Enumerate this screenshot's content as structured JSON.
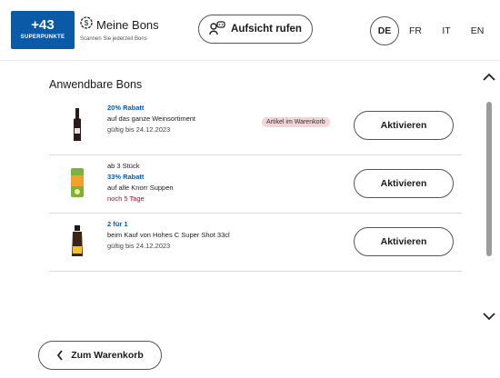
{
  "header": {
    "points_value": "+43",
    "points_label": "SUPERPUNKTE",
    "title": "Meine Bons",
    "subtitle": "Scannen Sie jederzeit Bons",
    "call_button": "Aufsicht rufen",
    "languages": [
      "DE",
      "FR",
      "IT",
      "EN"
    ],
    "active_language": "DE"
  },
  "section": {
    "title": "Anwendbare Bons"
  },
  "bons": [
    {
      "pre": "",
      "headline": "20% Rabatt",
      "description": "auf das ganze Weinsortiment",
      "footer": "gültig bis 24.12.2023",
      "footer_type": "valid",
      "badge": "Artikel im Warenkorb",
      "action": "Aktivieren",
      "image": "wine-bottle-icon"
    },
    {
      "pre": "ab 3 Stück",
      "headline": "33% Rabatt",
      "description": "auf alle Knorr Suppen",
      "footer": "noch 5 Tage",
      "footer_type": "warning",
      "badge": "",
      "action": "Aktivieren",
      "image": "soup-pack-icon"
    },
    {
      "pre": "",
      "headline": "2 für 1",
      "description": "beim Kauf von Hohes C Super Shot 33cl",
      "footer": "gültig bis 24.12.2023",
      "footer_type": "valid",
      "badge": "",
      "action": "Aktivieren",
      "image": "shot-bottle-icon"
    }
  ],
  "footer": {
    "back_button": "Zum Warenkorb"
  },
  "colors": {
    "brand": "#0a5aa8",
    "warning": "#d0021b",
    "badge_bg": "#f4d4d6"
  }
}
